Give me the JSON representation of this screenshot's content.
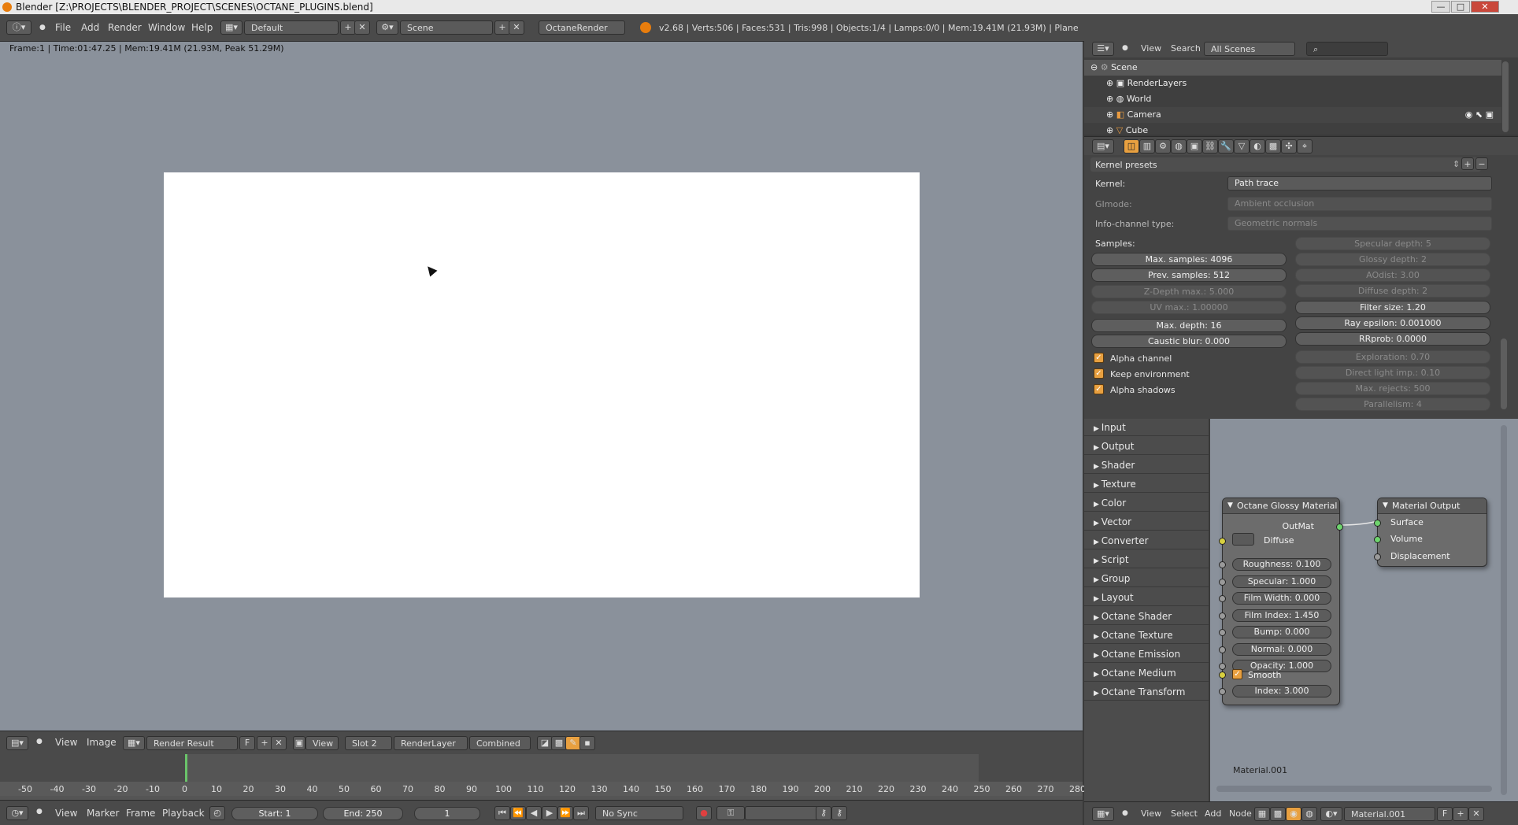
{
  "window": {
    "title": "Blender [Z:\\PROJECTS\\BLENDER_PROJECT\\SCENES\\OCTANE_PLUGINS.blend]",
    "controls": [
      "—",
      "□",
      "✕"
    ]
  },
  "top_menu": {
    "items": [
      "File",
      "Add",
      "Render",
      "Window",
      "Help"
    ],
    "layout": "Default",
    "scene": "Scene",
    "engine": "OctaneRender",
    "stats": "v2.68 | Verts:506 | Faces:531 | Tris:998 | Objects:1/4 | Lamps:0/0 | Mem:19.41M (21.93M) | Plane"
  },
  "image_editor": {
    "status": "Frame:1 | Time:01:47.25 | Mem:19.41M (21.93M, Peak 51.29M)",
    "header": {
      "menus": [
        "View",
        "Image"
      ],
      "image_name": "Render Result",
      "fake_user": "F",
      "view_label": "View",
      "slot": "Slot 2",
      "layer": "RenderLayer",
      "pass": "Combined"
    }
  },
  "timeline": {
    "ticks": [
      "-50",
      "-40",
      "-30",
      "-20",
      "-10",
      "0",
      "10",
      "20",
      "30",
      "40",
      "50",
      "60",
      "70",
      "80",
      "90",
      "100",
      "110",
      "120",
      "130",
      "140",
      "150",
      "160",
      "170",
      "180",
      "190",
      "200",
      "210",
      "220",
      "230",
      "240",
      "250",
      "260",
      "270",
      "280"
    ],
    "current_frame_value": 1,
    "header": {
      "menus": [
        "View",
        "Marker",
        "Frame",
        "Playback"
      ],
      "start": "Start: 1",
      "end": "End: 250",
      "current": "1",
      "sync": "No Sync"
    }
  },
  "outliner": {
    "header": {
      "view": "View",
      "search": "Search",
      "filter": "All Scenes"
    },
    "rows": [
      "Scene",
      "RenderLayers",
      "World",
      "Camera",
      "Cube"
    ]
  },
  "properties": {
    "presets_label": "Kernel presets",
    "kernel_label": "Kernel:",
    "kernel_value": "Path trace",
    "gimode_label": "GImode:",
    "gimode_value": "Ambient occlusion",
    "infochannel_label": "Info-channel type:",
    "infochannel_value": "Geometric normals",
    "samples_label": "Samples:",
    "left_sliders": [
      {
        "text": "Max. samples: 4096",
        "enabled": true
      },
      {
        "text": "Prev. samples: 512",
        "enabled": true
      },
      {
        "text": "Z-Depth max.: 5.000",
        "enabled": false
      },
      {
        "text": "UV max.: 1.00000",
        "enabled": false
      },
      {
        "text": "Max. depth: 16",
        "enabled": true
      },
      {
        "text": "Caustic blur: 0.000",
        "enabled": true
      }
    ],
    "right_sliders": [
      {
        "text": "Specular depth: 5",
        "enabled": false
      },
      {
        "text": "Glossy depth: 2",
        "enabled": false
      },
      {
        "text": "AOdist: 3.00",
        "enabled": false
      },
      {
        "text": "Diffuse depth: 2",
        "enabled": false
      },
      {
        "text": "Filter size: 1.20",
        "enabled": true
      },
      {
        "text": "Ray epsilon: 0.001000",
        "enabled": true
      },
      {
        "text": "RRprob: 0.0000",
        "enabled": true
      },
      {
        "text": "Exploration: 0.70",
        "enabled": false
      },
      {
        "text": "Direct light imp.: 0.10",
        "enabled": false
      },
      {
        "text": "Max. rejects: 500",
        "enabled": false
      },
      {
        "text": "Parallelism: 4",
        "enabled": false
      }
    ],
    "checkboxes": [
      {
        "label": "Alpha channel",
        "checked": true
      },
      {
        "label": "Keep environment",
        "checked": true
      },
      {
        "label": "Alpha shadows",
        "checked": true
      }
    ]
  },
  "node_editor": {
    "categories": [
      "Input",
      "Output",
      "Shader",
      "Texture",
      "Color",
      "Vector",
      "Converter",
      "Script",
      "Group",
      "Layout",
      "Octane Shader",
      "Octane Texture",
      "Octane Emission",
      "Octane Medium",
      "Octane Transform"
    ],
    "glossy_node": {
      "title": "Octane Glossy Material",
      "output": "OutMat",
      "diffuse": "Diffuse",
      "params": [
        "Roughness: 0.100",
        "Specular: 1.000",
        "Film Width: 0.000",
        "Film Index: 1.450",
        "Bump: 0.000",
        "Normal: 0.000",
        "Opacity: 1.000"
      ],
      "smooth": "Smooth",
      "index": "Index: 3.000"
    },
    "output_node": {
      "title": "Material Output",
      "inputs": [
        "Surface",
        "Volume",
        "Displacement"
      ]
    },
    "material_label": "Material.001",
    "header": {
      "menus": [
        "View",
        "Select",
        "Add",
        "Node"
      ],
      "material": "Material.001",
      "fake_user": "F"
    }
  }
}
